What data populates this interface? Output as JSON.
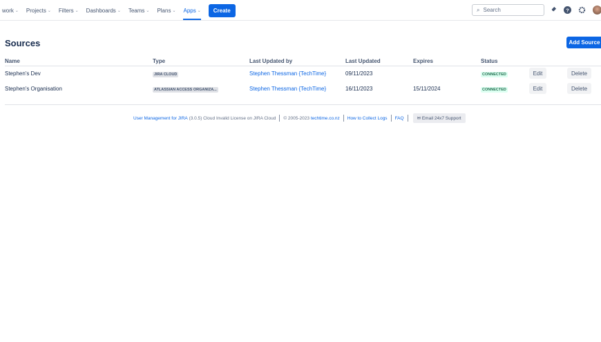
{
  "nav": {
    "items": [
      "work",
      "Projects",
      "Filters",
      "Dashboards",
      "Teams",
      "Plans",
      "Apps"
    ],
    "create": "Create",
    "search_placeholder": "Search"
  },
  "page": {
    "title": "Sources",
    "add_button": "Add Source"
  },
  "table": {
    "headers": [
      "Name",
      "Type",
      "Last Updated by",
      "Last Updated",
      "Expires",
      "Status"
    ],
    "rows": [
      {
        "name": "Stephen's Dev",
        "type": "JIRA CLOUD",
        "updated_by": "Stephen Thessman {TechTime}",
        "updated": "09/11/2023",
        "expires": "",
        "status": "CONNECTED",
        "edit": "Edit",
        "delete": "Delete"
      },
      {
        "name": "Stephen's Organisation",
        "type": "ATLASSIAN ACCESS ORGANIZA...",
        "updated_by": "Stephen Thessman {TechTime}",
        "updated": "16/11/2023",
        "expires": "15/11/2024",
        "status": "CONNECTED",
        "edit": "Edit",
        "delete": "Delete"
      }
    ]
  },
  "footer": {
    "product": "User Management for JIRA",
    "version": "(3.0.5) Cloud Invalid License on JIRA Cloud",
    "copyright": "© 2005-2023",
    "site": "techtime.co.nz",
    "logs": "How to Collect Logs",
    "faq": "FAQ",
    "email": "Email 24x7 Support"
  }
}
